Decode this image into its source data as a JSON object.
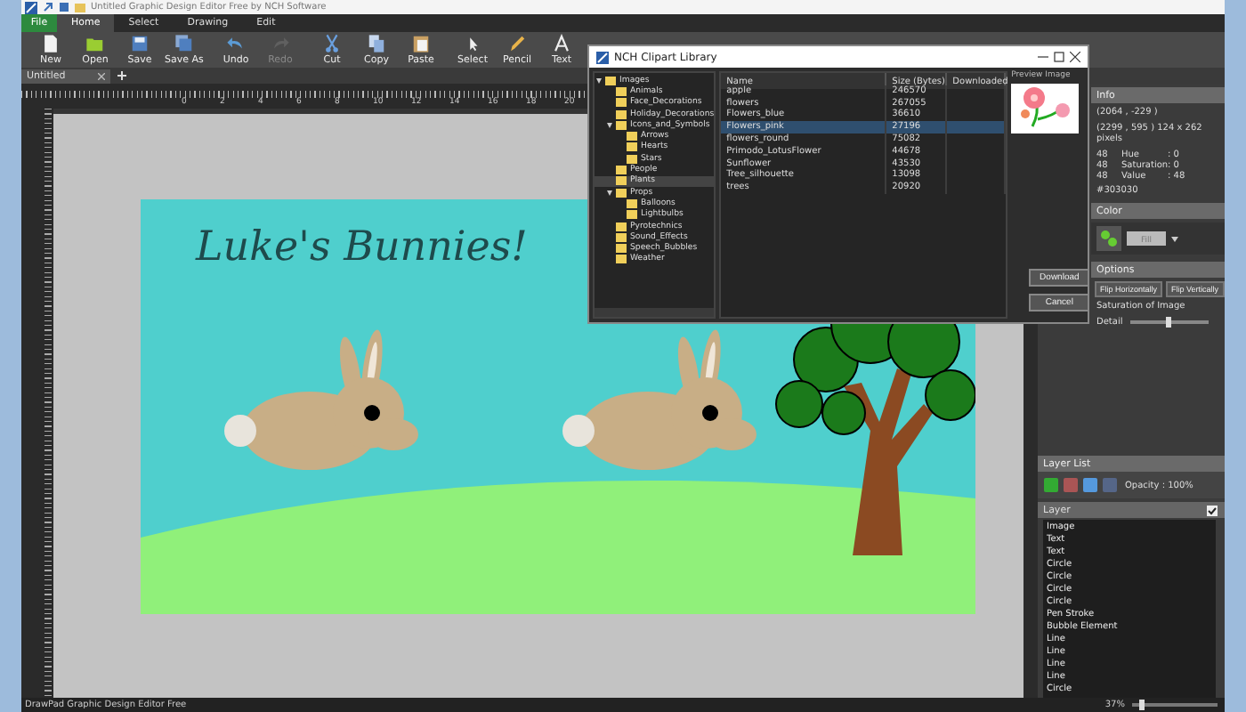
{
  "window": {
    "title": "Untitled Graphic Design Editor Free by NCH Software"
  },
  "file_menu": "File",
  "tabs": [
    {
      "label": "Home",
      "selected": true
    },
    {
      "label": "Select",
      "selected": false
    },
    {
      "label": "Drawing",
      "selected": false
    },
    {
      "label": "Edit",
      "selected": false
    }
  ],
  "toolbar": [
    {
      "label": "New",
      "disabled": false
    },
    {
      "label": "Open",
      "disabled": false
    },
    {
      "label": "Save",
      "disabled": false
    },
    {
      "label": "Save As",
      "disabled": false
    },
    {
      "label": "Undo",
      "disabled": false
    },
    {
      "label": "Redo",
      "disabled": true
    },
    {
      "label": "Cut",
      "disabled": false
    },
    {
      "label": "Copy",
      "disabled": false
    },
    {
      "label": "Paste",
      "disabled": false
    },
    {
      "label": "Select",
      "disabled": false
    },
    {
      "label": "Pencil",
      "disabled": false
    },
    {
      "label": "Text",
      "disabled": false
    }
  ],
  "document_tab": {
    "label": "Untitled"
  },
  "ruler": {
    "labels": [
      "0",
      "2",
      "4",
      "6",
      "8",
      "10",
      "12",
      "14",
      "16",
      "18",
      "20"
    ]
  },
  "canvas": {
    "title": "Luke's Bunnies!"
  },
  "clipart_dialog": {
    "title": "NCH Clipart Library",
    "tree": [
      {
        "label": "Images",
        "expanded": true,
        "selected": false,
        "children": [
          {
            "label": "Animals",
            "selected": false
          },
          {
            "label": "Face_Decorations",
            "selected": false
          },
          {
            "label": "Holiday_Decorations",
            "selected": false
          },
          {
            "label": "Icons_and_Symbols",
            "expanded": true,
            "selected": false,
            "children": [
              {
                "label": "Arrows",
                "selected": false
              },
              {
                "label": "Hearts",
                "selected": false
              },
              {
                "label": "Stars",
                "selected": false
              }
            ]
          },
          {
            "label": "People",
            "selected": false
          },
          {
            "label": "Plants",
            "selected": true
          },
          {
            "label": "Props",
            "expanded": true,
            "selected": false,
            "children": [
              {
                "label": "Balloons",
                "selected": false
              },
              {
                "label": "Lightbulbs",
                "selected": false
              }
            ]
          },
          {
            "label": "Pyrotechnics",
            "selected": false
          },
          {
            "label": "Sound_Effects",
            "selected": false
          },
          {
            "label": "Speech_Bubbles",
            "selected": false
          },
          {
            "label": "Weather",
            "selected": false
          }
        ]
      }
    ],
    "columns": [
      "Name",
      "Size (Bytes)",
      "Downloaded"
    ],
    "rows": [
      {
        "name": "apple",
        "size": "246570",
        "selected": false
      },
      {
        "name": "flowers",
        "size": "267055",
        "selected": false
      },
      {
        "name": "Flowers_blue",
        "size": "36610",
        "selected": false
      },
      {
        "name": "Flowers_pink",
        "size": "27196",
        "selected": true
      },
      {
        "name": "flowers_round",
        "size": "75082",
        "selected": false
      },
      {
        "name": "Primodo_LotusFlower",
        "size": "44678",
        "selected": false
      },
      {
        "name": "Sunflower",
        "size": "43530",
        "selected": false
      },
      {
        "name": "Tree_silhouette",
        "size": "13098",
        "selected": false
      },
      {
        "name": "trees",
        "size": "20920",
        "selected": false
      }
    ],
    "preview_label": "Preview Image",
    "buttons": [
      "Download",
      "Cancel"
    ]
  },
  "info_panel": {
    "title": "Info",
    "lines": [
      "(2064 , -229 )",
      "(2299 , 595 ) 124 x 262 pixels"
    ],
    "color_values": [
      {
        "value": "48",
        "name": "Hue",
        "reading": ": 0"
      },
      {
        "value": "48",
        "name": "Saturation",
        "reading": ": 0"
      },
      {
        "value": "48",
        "name": "Value",
        "reading": ": 48"
      }
    ],
    "hex": "#303030"
  },
  "color_panel": {
    "title": "Color",
    "fill_label": "Fill"
  },
  "options_panel": {
    "title": "Options",
    "buttons": [
      "Flip Horizontally",
      "Flip Vertically"
    ],
    "note": "Saturation of Image",
    "slider": {
      "label": "Detail",
      "level": 0.5
    }
  },
  "layer_list": {
    "title": "Layer List",
    "opacity": "Opacity : 100%",
    "layer_header": {
      "label": "Layer",
      "checked": true
    },
    "layers": [
      "Image",
      "Text",
      "Text",
      "Circle",
      "Circle",
      "Circle",
      "Circle",
      "Pen Stroke",
      "Bubble Element",
      "Line",
      "Line",
      "Line",
      "Line",
      "Circle"
    ]
  },
  "status_bar": {
    "text": "DrawPad Graphic Design Editor Free",
    "zoom": "37%",
    "zoom_slider": {
      "level": 0.12
    }
  }
}
